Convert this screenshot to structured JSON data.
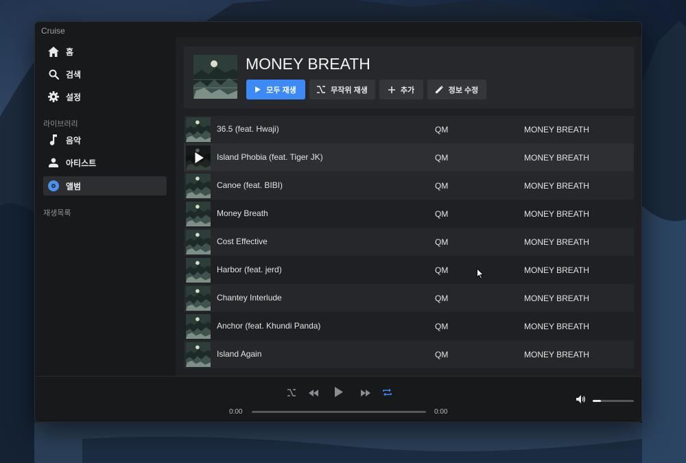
{
  "app": {
    "title": "Cruise"
  },
  "sidebar": {
    "items": [
      {
        "label": "홈",
        "icon": "home-icon"
      },
      {
        "label": "검색",
        "icon": "search-icon"
      },
      {
        "label": "설정",
        "icon": "gear-icon"
      }
    ],
    "library_label": "라이브러리",
    "library_items": [
      {
        "label": "음악",
        "icon": "music-note-icon"
      },
      {
        "label": "아티스트",
        "icon": "person-icon"
      },
      {
        "label": "앨범",
        "icon": "album-icon",
        "active": true
      }
    ],
    "playlists_label": "재생목록"
  },
  "album": {
    "title": "MONEY BREATH",
    "buttons": {
      "play_all": "모두 재생",
      "shuffle": "무작위 재생",
      "add": "추가",
      "edit_info": "정보 수정"
    }
  },
  "tracks": [
    {
      "title": "36.5 (feat. Hwaji)",
      "artist": "QM",
      "album": "MONEY BREATH"
    },
    {
      "title": "Island Phobia (feat. Tiger JK)",
      "artist": "QM",
      "album": "MONEY BREATH"
    },
    {
      "title": "Canoe (feat. BIBI)",
      "artist": "QM",
      "album": "MONEY BREATH"
    },
    {
      "title": "Money Breath",
      "artist": "QM",
      "album": "MONEY BREATH"
    },
    {
      "title": "Cost Effective",
      "artist": "QM",
      "album": "MONEY BREATH"
    },
    {
      "title": "Harbor (feat. jerd)",
      "artist": "QM",
      "album": "MONEY BREATH"
    },
    {
      "title": "Chantey Interlude",
      "artist": "QM",
      "album": "MONEY BREATH"
    },
    {
      "title": "Anchor (feat. Khundi Panda)",
      "artist": "QM",
      "album": "MONEY BREATH"
    },
    {
      "title": "Island Again",
      "artist": "QM",
      "album": "MONEY BREATH"
    }
  ],
  "player": {
    "current_time": "0:00",
    "total_time": "0:00",
    "progress": 0,
    "volume": 0.2,
    "repeat_color": "#3d8af7"
  },
  "colors": {
    "accent": "#3d8af7",
    "background": "#18191b",
    "panel": "#26282b"
  }
}
